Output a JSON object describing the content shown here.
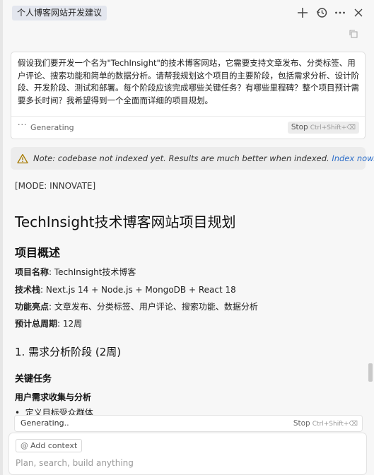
{
  "header": {
    "tab_title": "个人博客网站开发建议",
    "icons": [
      "plus-icon",
      "history-icon",
      "more-icon",
      "close-icon",
      "copy-icon"
    ]
  },
  "prompt": {
    "text": "假设我们要开发一个名为\"TechInsight\"的技术博客网站，它需要支持文章发布、分类标签、用户评论、搜索功能和简单的数据分析。请帮我规划这个项目的主要阶段，包括需求分析、设计阶段、开发阶段、测试和部署。每个阶段应该完成哪些关键任务？有哪些里程碑？整个项目预计需要多长时间？我希望得到一个全面而详细的项目规划。",
    "status": "Generating",
    "stop_label": "Stop",
    "stop_shortcut": "Ctrl+Shift+⌫"
  },
  "notice": {
    "text": "Note: codebase not indexed yet. Results are much better when indexed.",
    "link": "Index now."
  },
  "response": {
    "mode": "[MODE: INNOVATE]",
    "title": "TechInsight技术博客网站项目规划",
    "overview_heading": "项目概述",
    "overview": [
      {
        "label": "项目名称",
        "value": ": TechInsight技术博客"
      },
      {
        "label": "技术栈",
        "value": ": Next.js 14 + Node.js + MongoDB + React 18"
      },
      {
        "label": "功能亮点",
        "value": ": 文章发布、分类标签、用户评论、搜索功能、数据分析"
      },
      {
        "label": "预计总周期",
        "value": ": 12周"
      }
    ],
    "phase1_heading": "1. 需求分析阶段 (2周)",
    "key_tasks_heading": "关键任务",
    "subtask_heading": "用户需求收集与分析",
    "bullet_1": "定义目标受众群体"
  },
  "generating_bar": {
    "label": "Generating..",
    "stop_label": "Stop",
    "stop_shortcut": "Ctrl+Shift+⌫"
  },
  "composer": {
    "add_context": "Add context",
    "placeholder": "Plan, search, build anything"
  }
}
